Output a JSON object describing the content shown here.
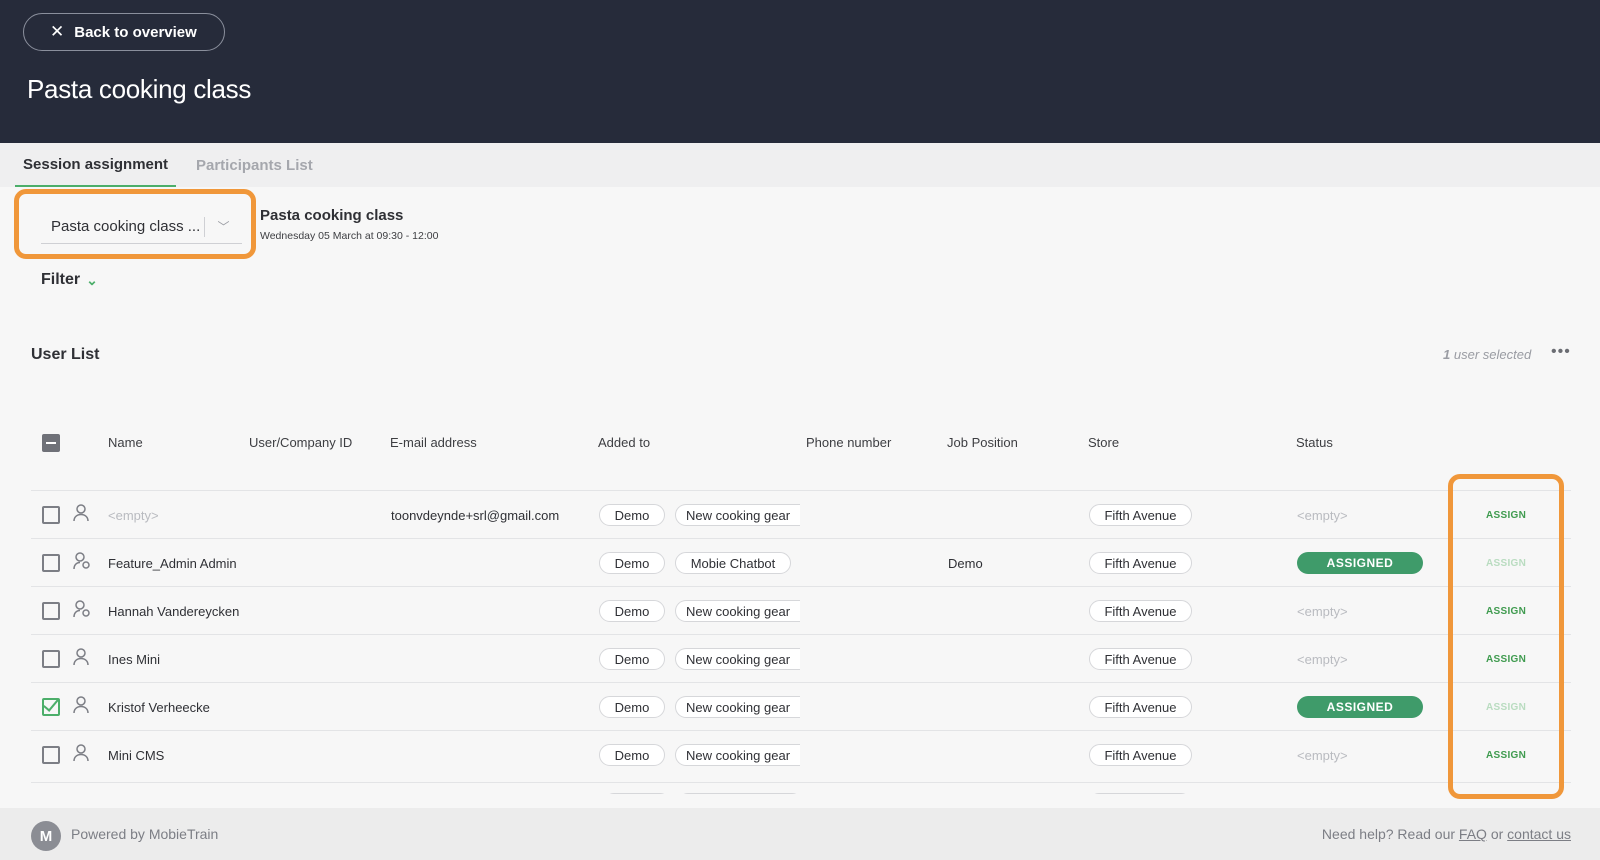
{
  "header": {
    "back_label": "Back to overview",
    "title": "Pasta cooking class"
  },
  "tabs": [
    {
      "label": "Session assignment",
      "active": true
    },
    {
      "label": "Participants List",
      "active": false
    }
  ],
  "session": {
    "select_value": "Pasta cooking class ...",
    "title": "Pasta cooking class",
    "date": "Wednesday 05 March at 09:30 - 12:00"
  },
  "filter_label": "Filter",
  "user_list": {
    "title": "User List",
    "selected_count": "1",
    "selected_suffix": "user selected"
  },
  "columns": [
    "Name",
    "User/Company ID",
    "E-mail address",
    "Added to",
    "Phone number",
    "Job Position",
    "Store",
    "Status"
  ],
  "rows": [
    {
      "name": "<empty>",
      "email": "toonvdeynde+srl@gmail.com",
      "added": [
        "Demo",
        "New cooking gear"
      ],
      "job": "",
      "store": "Fifth Avenue",
      "status": "<empty>",
      "assign": "ASSIGN",
      "assign_enabled": true,
      "checked": false,
      "icon": "user-icon"
    },
    {
      "name": "Feature_Admin Admin",
      "email": "",
      "added": [
        "Demo",
        "Mobie Chatbot"
      ],
      "job": "Demo",
      "store": "Fifth Avenue",
      "status": "ASSIGNED",
      "assign": "ASSIGN",
      "assign_enabled": false,
      "checked": false,
      "icon": "admin-user-icon"
    },
    {
      "name": "Hannah Vandereycken",
      "email": "",
      "added": [
        "Demo",
        "New cooking gear"
      ],
      "job": "",
      "store": "Fifth Avenue",
      "status": "<empty>",
      "assign": "ASSIGN",
      "assign_enabled": true,
      "checked": false,
      "icon": "admin-user-icon"
    },
    {
      "name": "Ines Mini",
      "email": "",
      "added": [
        "Demo",
        "New cooking gear"
      ],
      "job": "",
      "store": "Fifth Avenue",
      "status": "<empty>",
      "assign": "ASSIGN",
      "assign_enabled": true,
      "checked": false,
      "icon": "user-icon"
    },
    {
      "name": "Kristof Verheecke",
      "email": "",
      "added": [
        "Demo",
        "New cooking gear"
      ],
      "job": "",
      "store": "Fifth Avenue",
      "status": "ASSIGNED",
      "assign": "ASSIGN",
      "assign_enabled": false,
      "checked": true,
      "icon": "user-icon"
    },
    {
      "name": "Mini CMS",
      "email": "",
      "added": [
        "Demo",
        "New cooking gear"
      ],
      "job": "",
      "store": "Fifth Avenue",
      "status": "<empty>",
      "assign": "ASSIGN",
      "assign_enabled": true,
      "checked": false,
      "icon": "user-icon"
    }
  ],
  "footer": {
    "powered": "Powered by MobieTrain",
    "logo_letter": "M",
    "help_prefix": "Need help? Read our",
    "faq": "FAQ",
    "or": "or",
    "contact": "contact us"
  },
  "colors": {
    "header_bg": "#262b3a",
    "accent_green": "#4cae6a",
    "assigned_badge": "#3f9b6a",
    "highlight_orange": "#f0973a"
  }
}
